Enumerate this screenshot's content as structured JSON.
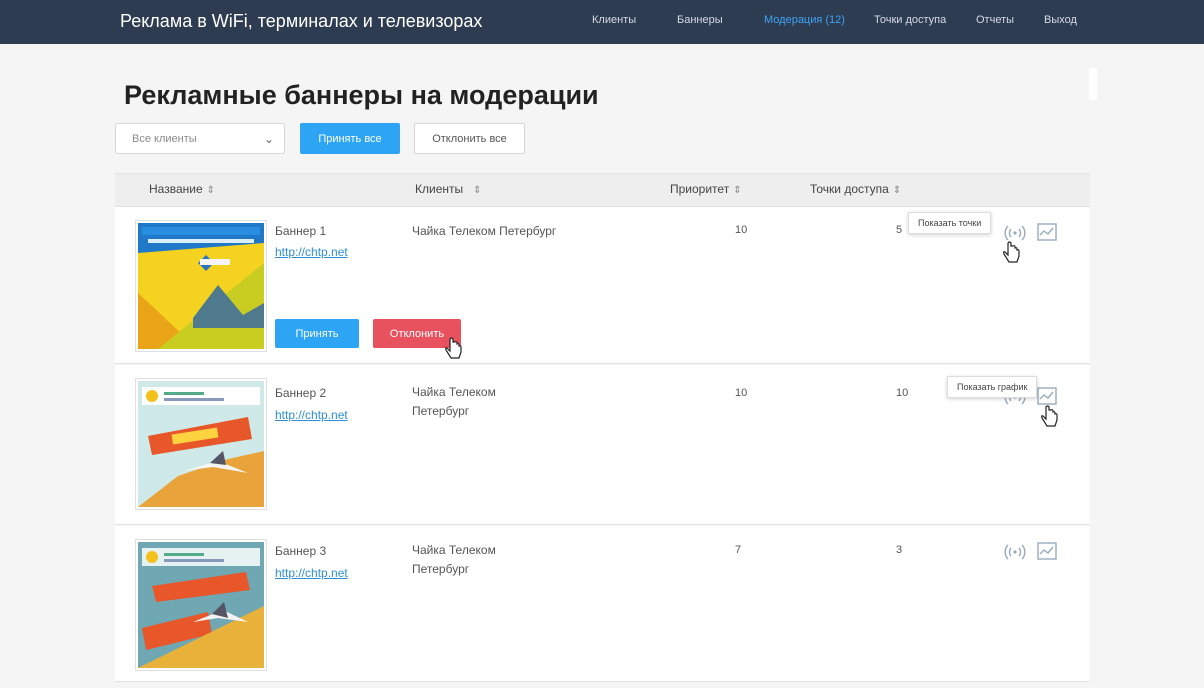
{
  "app": {
    "title": "Реклама в WiFi, терминалах и телевизорах"
  },
  "nav": {
    "items": [
      {
        "label": "Клиенты"
      },
      {
        "label": "Баннеры"
      },
      {
        "label": "Модерация (12)",
        "active": true
      },
      {
        "label": "Точки доступа"
      },
      {
        "label": "Отчеты"
      },
      {
        "label": "Выход"
      }
    ]
  },
  "page": {
    "title": "Рекламные баннеры на модерации"
  },
  "toolbar": {
    "client_select": {
      "value": "Все клиенты"
    },
    "accept_all_label": "Принять все",
    "reject_all_label": "Отклонить все"
  },
  "table": {
    "headers": {
      "name": "Название",
      "clients": "Клиенты",
      "priority": "Приоритет",
      "points": "Точки доступа"
    },
    "rows": [
      {
        "name": "Баннер 1",
        "link": "http://chtp.net",
        "client": "Чайка Телеком Петербург",
        "priority": "10",
        "points": "5",
        "accept_label": "Принять",
        "reject_label": "Отклонить",
        "tooltip": "Показать точки"
      },
      {
        "name": "Баннер 2",
        "link": "http://chtp.net",
        "client_line1": "Чайка Телеком",
        "client_line2": "Петербург",
        "priority": "10",
        "points": "10",
        "tooltip": "Показать график"
      },
      {
        "name": "Баннер 3",
        "link": "http://chtp.net",
        "client_line1": "Чайка Телеком",
        "client_line2": "Петербург",
        "priority": "7",
        "points": "3"
      }
    ]
  },
  "colors": {
    "navbar_bg": "#2e3c52",
    "nav_active": "#3ea4f5",
    "primary": "#2ea4f5",
    "danger": "#e8525f",
    "link": "#2e8fd6"
  },
  "icons": {
    "access_point": "wifi-signal-icon",
    "chart": "line-chart-icon",
    "cursor": "hand-pointer-icon",
    "select_arrow": "chevron-down-icon"
  }
}
